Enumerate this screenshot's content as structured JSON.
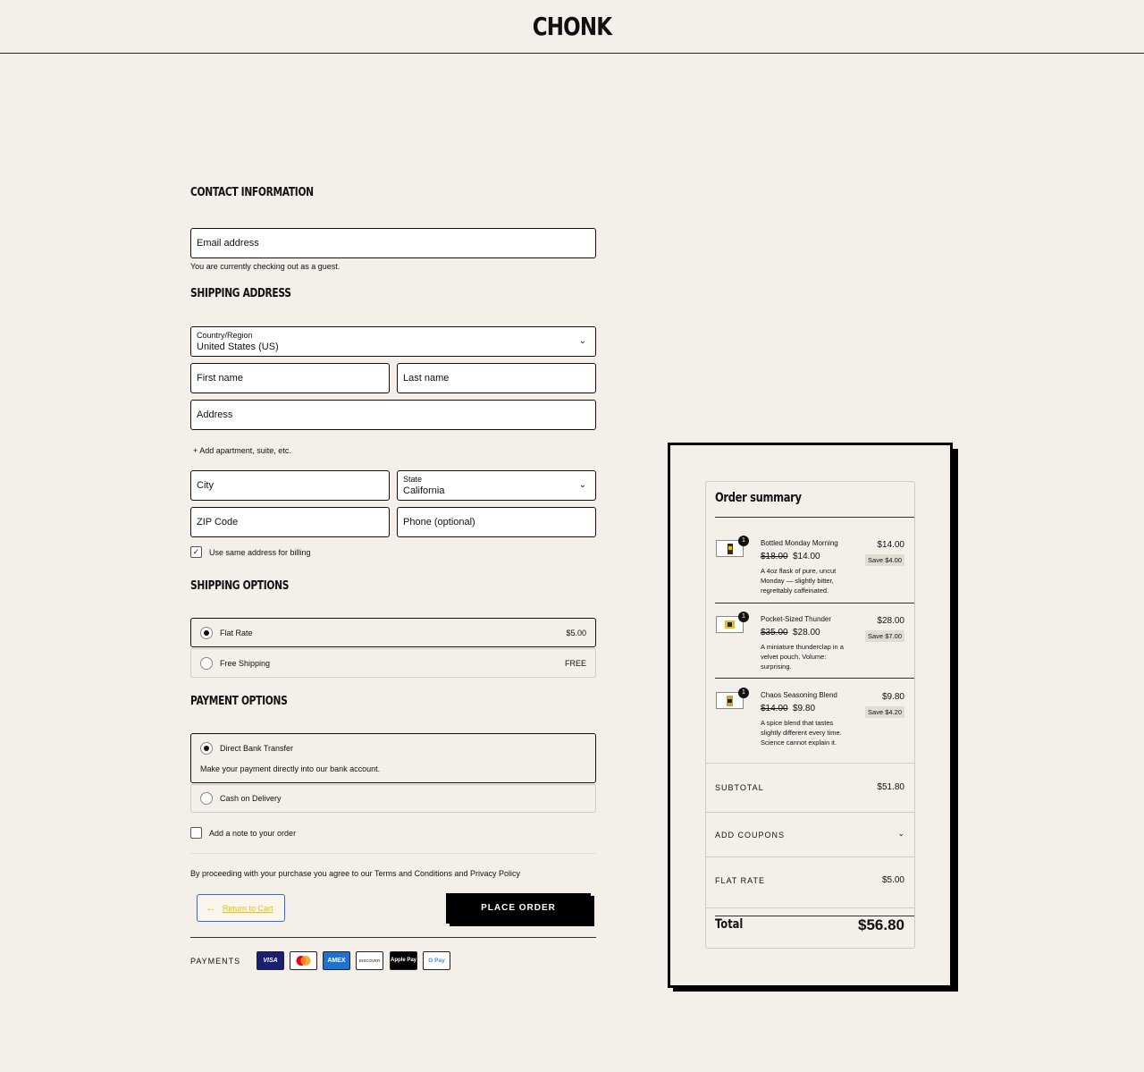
{
  "brand": "CHONK",
  "contact": {
    "heading": "CONTACT INFORMATION",
    "email_placeholder": "Email address",
    "guest_note": "You are currently checking out as a guest."
  },
  "shipping": {
    "heading": "SHIPPING ADDRESS",
    "country_label": "Country/Region",
    "country_value": "United States (US)",
    "first_name": "First name",
    "last_name": "Last name",
    "address": "Address",
    "add_apartment": "+ Add apartment, suite, etc.",
    "city": "City",
    "state_label": "State",
    "state_value": "California",
    "zip": "ZIP Code",
    "phone": "Phone (optional)",
    "same_billing": "Use same address for billing",
    "same_billing_checked": true
  },
  "shipping_options": {
    "heading": "SHIPPING OPTIONS",
    "options": [
      {
        "label": "Flat Rate",
        "price": "$5.00",
        "selected": true
      },
      {
        "label": "Free Shipping",
        "price": "FREE",
        "selected": false
      }
    ]
  },
  "payment_options": {
    "heading": "PAYMENT OPTIONS",
    "options": [
      {
        "label": "Direct Bank Transfer",
        "description": "Make your payment directly into our bank account.",
        "selected": true
      },
      {
        "label": "Cash on Delivery",
        "selected": false
      }
    ]
  },
  "order_note": "Add a note to your order",
  "terms": "By proceeding with your purchase you agree to our Terms and Conditions and Privacy Policy",
  "return_label": "Return to Cart",
  "place_order": "PLACE ORDER",
  "payments_label": "PAYMENTS",
  "payment_cards": [
    "VISA",
    "mastercard",
    "AMEX",
    "DISCOVER",
    "Apple Pay",
    "G Pay"
  ],
  "summary": {
    "title": "Order summary",
    "items": [
      {
        "name": "Bottled Monday Morning",
        "qty": "1",
        "old_price": "$18.00",
        "new_price": "$14.00",
        "desc": "A 4oz flask of pure, uncut Monday — slightly bitter, regrettably caffeinated.",
        "line_price": "$14.00",
        "save": "Save $4.00"
      },
      {
        "name": "Pocket-Sized Thunder",
        "qty": "1",
        "old_price": "$35.00",
        "new_price": "$28.00",
        "desc": "A miniature thunderclap in a velvet pouch. Volume: surprising.",
        "line_price": "$28.00",
        "save": "Save $7.00"
      },
      {
        "name": "Chaos Seasoning Blend",
        "qty": "1",
        "old_price": "$14.00",
        "new_price": "$9.80",
        "desc": "A spice blend that tastes slightly different every time. Science cannot explain it.",
        "line_price": "$9.80",
        "save": "Save $4.20"
      }
    ],
    "subtotal_label": "SUBTOTAL",
    "subtotal": "$51.80",
    "coupons_label": "ADD COUPONS",
    "shipping_label": "FLAT RATE",
    "shipping_value": "$5.00",
    "total_label": "Total",
    "total": "$56.80"
  }
}
